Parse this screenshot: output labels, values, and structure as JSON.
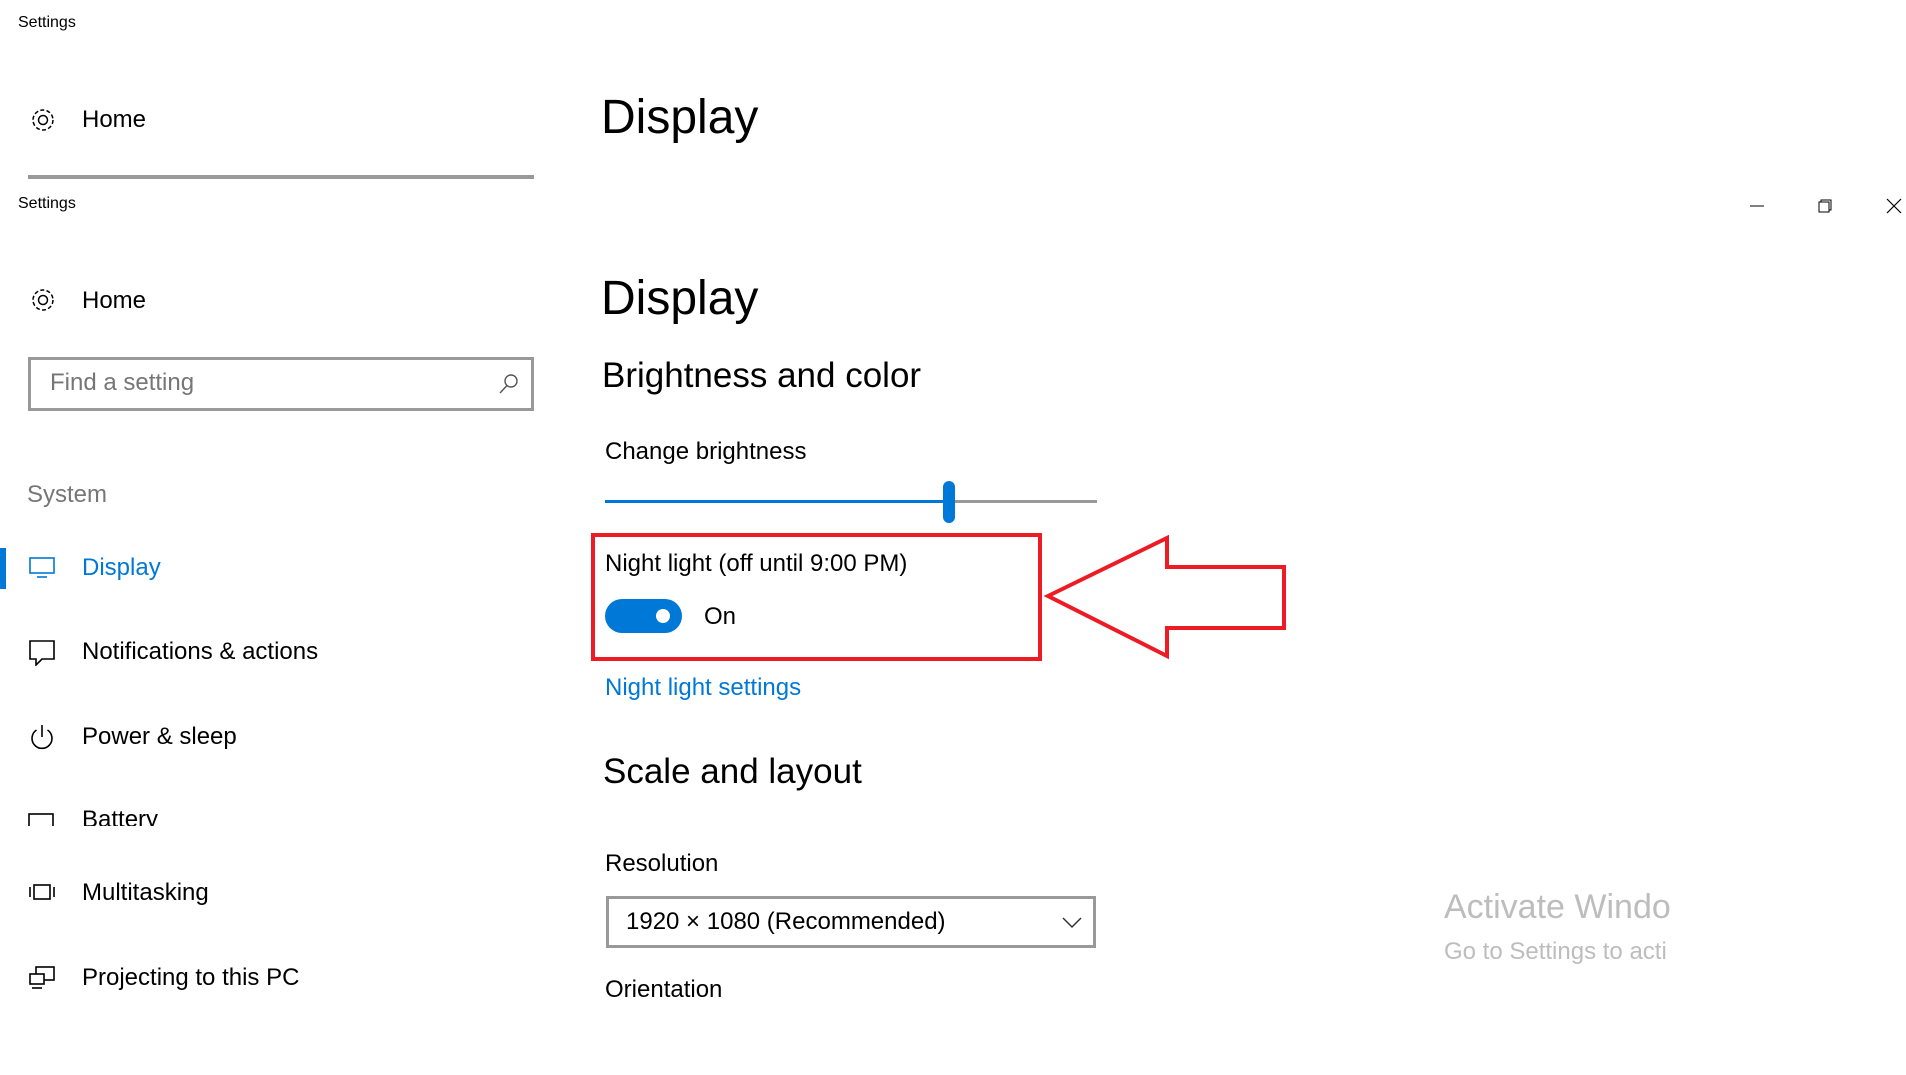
{
  "window": {
    "title": "Settings",
    "controls": {
      "minimize_icon": "minimize-icon",
      "restore_icon": "restore-icon",
      "close_icon": "close-icon"
    }
  },
  "ghost": {
    "title": "Settings",
    "home_label": "Home",
    "page_title": "Display"
  },
  "sidebar": {
    "home_label": "Home",
    "search_placeholder": "Find a setting",
    "section_label": "System",
    "items": [
      {
        "label": "Display",
        "icon": "monitor-icon",
        "selected": true
      },
      {
        "label": "Notifications & actions",
        "icon": "notification-icon"
      },
      {
        "label": "Power & sleep",
        "icon": "power-icon"
      },
      {
        "label": "Battery",
        "icon": "battery-icon"
      },
      {
        "label": "Multitasking",
        "icon": "multitasking-icon"
      },
      {
        "label": "Projecting to this PC",
        "icon": "projecting-icon"
      }
    ]
  },
  "main": {
    "page_title": "Display",
    "brightness_section": "Brightness and color",
    "brightness_label": "Change brightness",
    "brightness_value": 70,
    "night_light_label": "Night light (off until 9:00 PM)",
    "night_light_toggle": "On",
    "night_light_on": true,
    "night_light_settings_link": "Night light settings",
    "scale_section": "Scale and layout",
    "resolution_label": "Resolution",
    "resolution_value": "1920 × 1080 (Recommended)",
    "orientation_label": "Orientation"
  },
  "watermark": {
    "line1": "Activate Windo",
    "line2": "Go to Settings to acti"
  },
  "colors": {
    "accent": "#0078d7",
    "annotation": "#ed1c24"
  }
}
